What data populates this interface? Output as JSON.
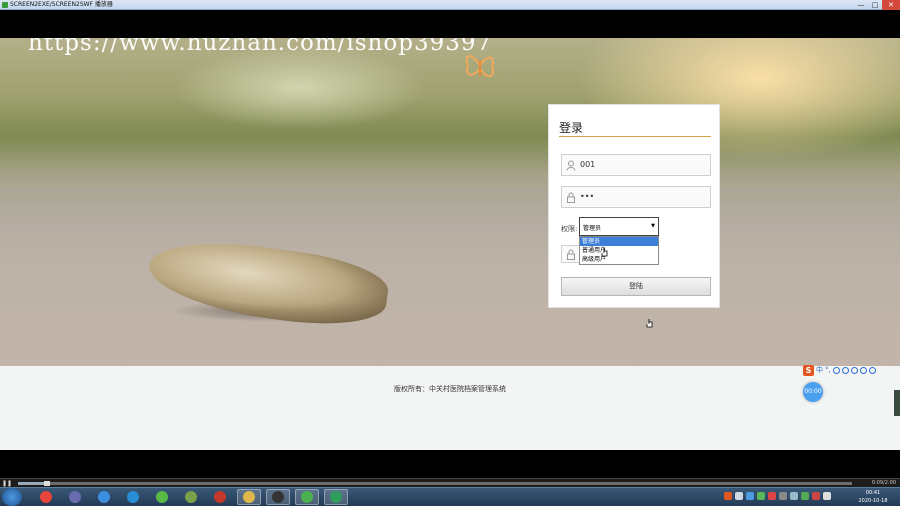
{
  "window": {
    "title": "SCREEN2EXE/SCREEN2SWF 播放器",
    "controls": [
      "—",
      "□",
      "✕"
    ]
  },
  "watermark": "https://www.huzhan.com/ishop39397",
  "login": {
    "title": "登录",
    "username_value": "001",
    "password_value": "•••",
    "role_label": "权限:",
    "role_selected": "管理员",
    "role_options": [
      "管理员",
      "普通用户",
      "高级用户"
    ],
    "submit_label": "登陆"
  },
  "footer": {
    "copyright": "版权所有：中关村医院档案管理系统"
  },
  "ime": {
    "logo": "S",
    "mode": "中",
    "punct": "°,"
  },
  "float_badge": "00:00",
  "player": {
    "progress": 0.035,
    "time": "0:09/2:00"
  },
  "taskbar": {
    "apps": [
      "chrome-icon",
      "media-player-icon",
      "baidu-cloud-icon",
      "browser-icon",
      "360-icon",
      "app-icon",
      "flash-icon",
      "folder-icon",
      "qq-icon",
      "wechat-icon",
      "recorder-icon"
    ],
    "clock_time": "00:41",
    "clock_date": "2020-10-18"
  },
  "colors": {
    "accent_line": "#d7a24a",
    "selected_option": "#3b7fd8",
    "taskbar": "#223a55"
  }
}
